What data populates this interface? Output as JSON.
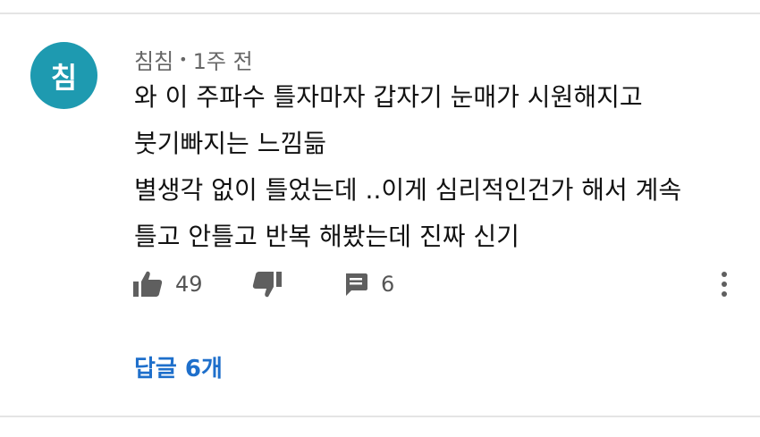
{
  "comment": {
    "avatar_initial": "침",
    "author": "침침",
    "separator": "•",
    "timestamp": "1주 전",
    "text_lines": [
      "와 이 주파수 틀자마자 갑자기 눈매가 시원해지고",
      "붓기빠지는 느낌듦",
      "별생각 없이 틀었는데 ..이게 심리적인건가 해서 계속",
      "틀고 안틀고 반복 해봤는데 진짜 신기"
    ],
    "like_count": "49",
    "reply_count": "6",
    "replies_label": "답글 6개"
  },
  "icons": {
    "like": "thumbs-up-icon",
    "dislike": "thumbs-down-icon",
    "reply": "comment-icon",
    "more": "more-vertical-icon"
  },
  "colors": {
    "avatar_bg": "#1e9ab0",
    "link": "#1e6fcb",
    "icon": "#5f5f5f",
    "divider": "#e4e4e4"
  }
}
